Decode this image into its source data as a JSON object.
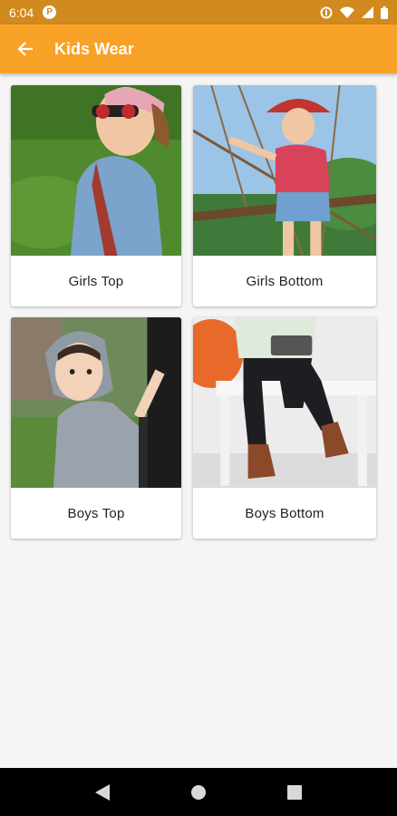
{
  "status_bar": {
    "time": "6:04",
    "app_icon_glyph": "P",
    "icons": [
      "data-saver-icon",
      "wifi-icon",
      "signal-icon",
      "battery-icon"
    ]
  },
  "app_bar": {
    "title": "Kids Wear",
    "back_icon": "arrow-back-icon",
    "color": "#f8a227"
  },
  "categories": [
    {
      "label": "Girls Top"
    },
    {
      "label": "Girls Bottom"
    },
    {
      "label": "Boys Top"
    },
    {
      "label": "Boys Bottom"
    }
  ],
  "nav_bar": {
    "icons": [
      "back-triangle-icon",
      "home-circle-icon",
      "recents-square-icon"
    ]
  }
}
